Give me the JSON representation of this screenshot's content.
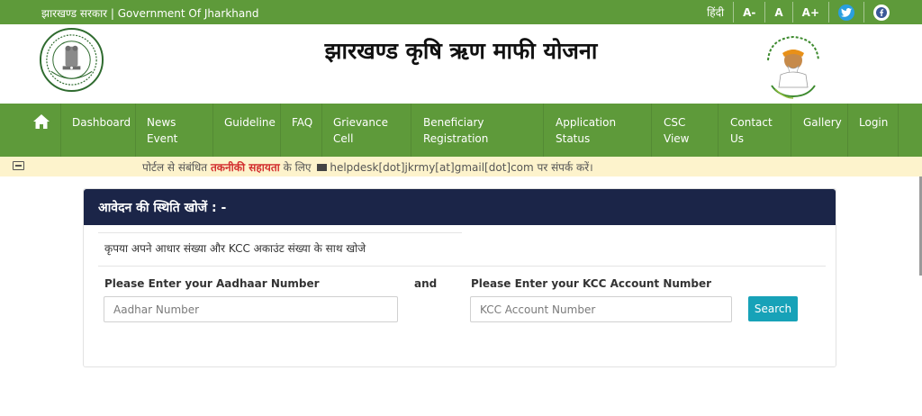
{
  "topbar": {
    "govt_text": "झारखण्ड सरकार | Government Of Jharkhand",
    "tools": [
      "हिंदी",
      "A-",
      "A",
      "A+"
    ],
    "social_icons": [
      "twitter-icon",
      "facebook-icon"
    ]
  },
  "header": {
    "title": "झारखण्ड कृषि ऋण माफी योजना"
  },
  "nav": {
    "items": [
      {
        "line1": "Dashboard",
        "line2": ""
      },
      {
        "line1": "News",
        "line2": "Event"
      },
      {
        "line1": "Guideline",
        "line2": ""
      },
      {
        "line1": "FAQ",
        "line2": ""
      },
      {
        "line1": "Grievance",
        "line2": "Cell"
      },
      {
        "line1": "Beneficiary",
        "line2": "Registration"
      },
      {
        "line1": "Application",
        "line2": "Status"
      },
      {
        "line1": "CSC",
        "line2": "View"
      },
      {
        "line1": "Contact",
        "line2": "Us"
      },
      {
        "line1": "Gallery",
        "line2": ""
      },
      {
        "line1": "Login",
        "line2": ""
      }
    ]
  },
  "notice": {
    "part1": "पोर्टल से संबंधित ",
    "highlight": "तकनीकी सहायता",
    "part2": " के लिए ",
    "email": "helpdesk[dot]jkrmy[at]gmail[dot]com",
    "part3": " पर संपर्क करें।"
  },
  "card": {
    "heading": "आवेदन की स्थिति खोजें : -",
    "hint": "कृपया अपने आधार संख्या और KCC अकाउंट संख्या के साथ खोजे",
    "aadhaar_label": "Please Enter your Aadhaar Number",
    "aadhaar_placeholder": "Aadhar Number",
    "and_text": "and",
    "kcc_label": "Please Enter your KCC Account Number",
    "kcc_placeholder": "KCC Account Number",
    "search_label": "Search"
  },
  "colors": {
    "green": "#5e9a3a",
    "navy": "#1b2548",
    "notice_bg": "#fdf3cc",
    "highlight_red": "#d22e2e",
    "button_teal": "#17a2b8"
  }
}
